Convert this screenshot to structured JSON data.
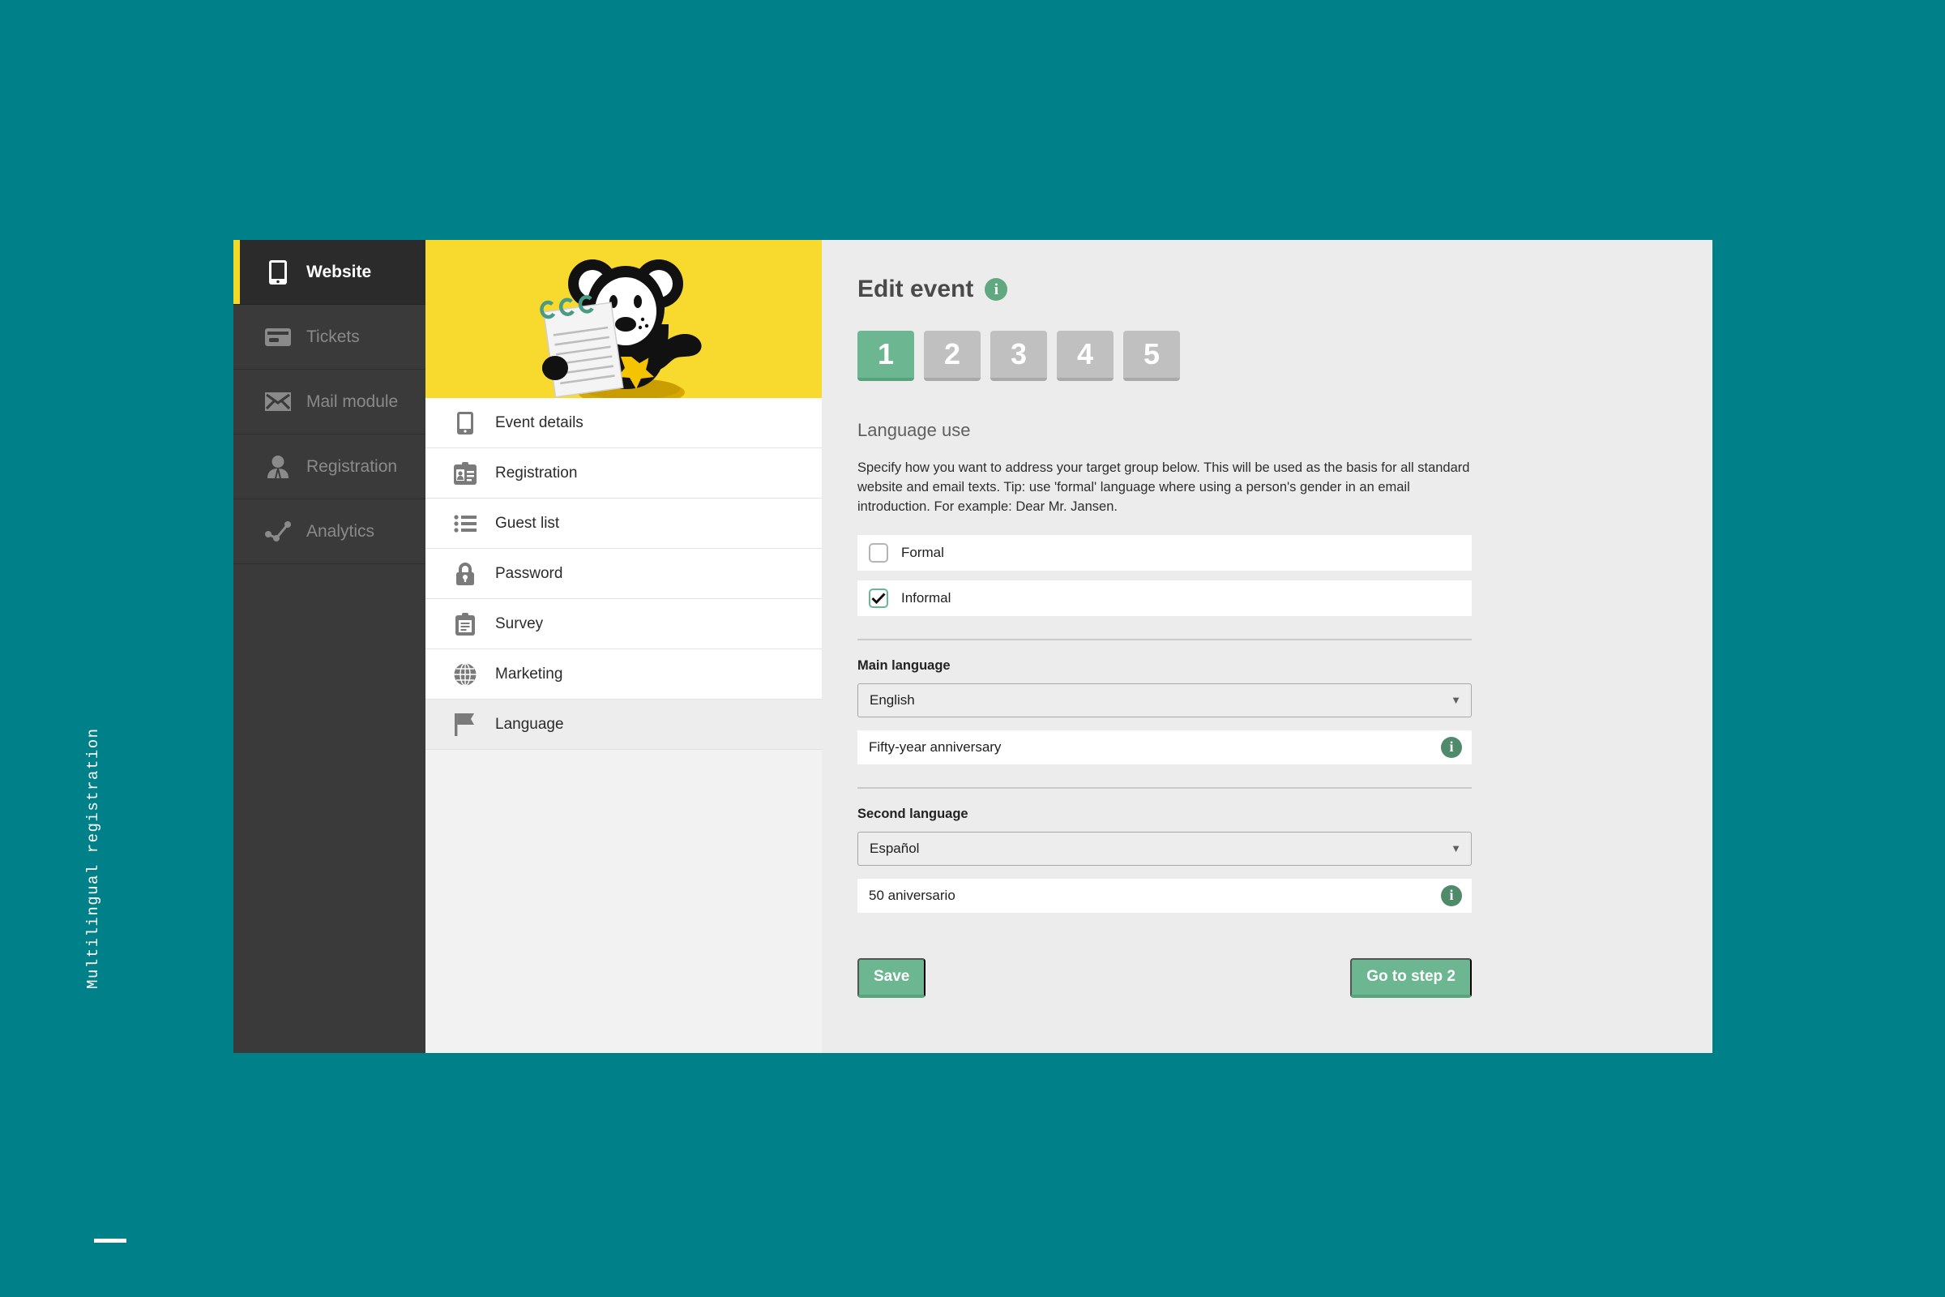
{
  "caption": "Multilingual registration",
  "sidebar": {
    "items": [
      {
        "label": "Website",
        "icon": "mobile-icon",
        "active": true
      },
      {
        "label": "Tickets",
        "icon": "ticket-icon",
        "active": false
      },
      {
        "label": "Mail module",
        "icon": "envelope-icon",
        "active": false
      },
      {
        "label": "Registration",
        "icon": "user-icon",
        "active": false
      },
      {
        "label": "Analytics",
        "icon": "analytics-icon",
        "active": false
      }
    ]
  },
  "subnav": {
    "logo": "mouse-mascot-logo",
    "items": [
      {
        "label": "Event details",
        "icon": "mobile-icon",
        "active": false
      },
      {
        "label": "Registration",
        "icon": "id-card-icon",
        "active": false
      },
      {
        "label": "Guest list",
        "icon": "list-icon",
        "active": false
      },
      {
        "label": "Password",
        "icon": "lock-icon",
        "active": false
      },
      {
        "label": "Survey",
        "icon": "clipboard-icon",
        "active": false
      },
      {
        "label": "Marketing",
        "icon": "globe-icon",
        "active": false
      },
      {
        "label": "Language",
        "icon": "flag-icon",
        "active": true
      }
    ]
  },
  "main": {
    "title": "Edit event",
    "title_info_icon": "info-icon",
    "steps": [
      {
        "label": "1",
        "current": true
      },
      {
        "label": "2",
        "current": false
      },
      {
        "label": "3",
        "current": false
      },
      {
        "label": "4",
        "current": false
      },
      {
        "label": "5",
        "current": false
      }
    ],
    "section_title": "Language use",
    "description": "Specify how you want to address your target group below. This will be used as the basis for all standard website and email texts. Tip: use 'formal' language where using a person's gender in an email introduction. For example: Dear Mr. Jansen.",
    "options": [
      {
        "label": "Formal",
        "checked": false
      },
      {
        "label": "Informal",
        "checked": true
      }
    ],
    "main_language": {
      "label": "Main language",
      "selected": "English",
      "title_value": "Fifty-year anniversary",
      "info_icon": "info-icon"
    },
    "second_language": {
      "label": "Second language",
      "selected": "Español",
      "title_value": "50 aniversario",
      "info_icon": "info-icon"
    },
    "save_label": "Save",
    "next_label": "Go to step 2"
  },
  "colors": {
    "background": "#00818a",
    "accent_yellow": "#f8d92e",
    "accent_green": "#6cb791",
    "sidebar_dark": "#3a3a3a"
  }
}
